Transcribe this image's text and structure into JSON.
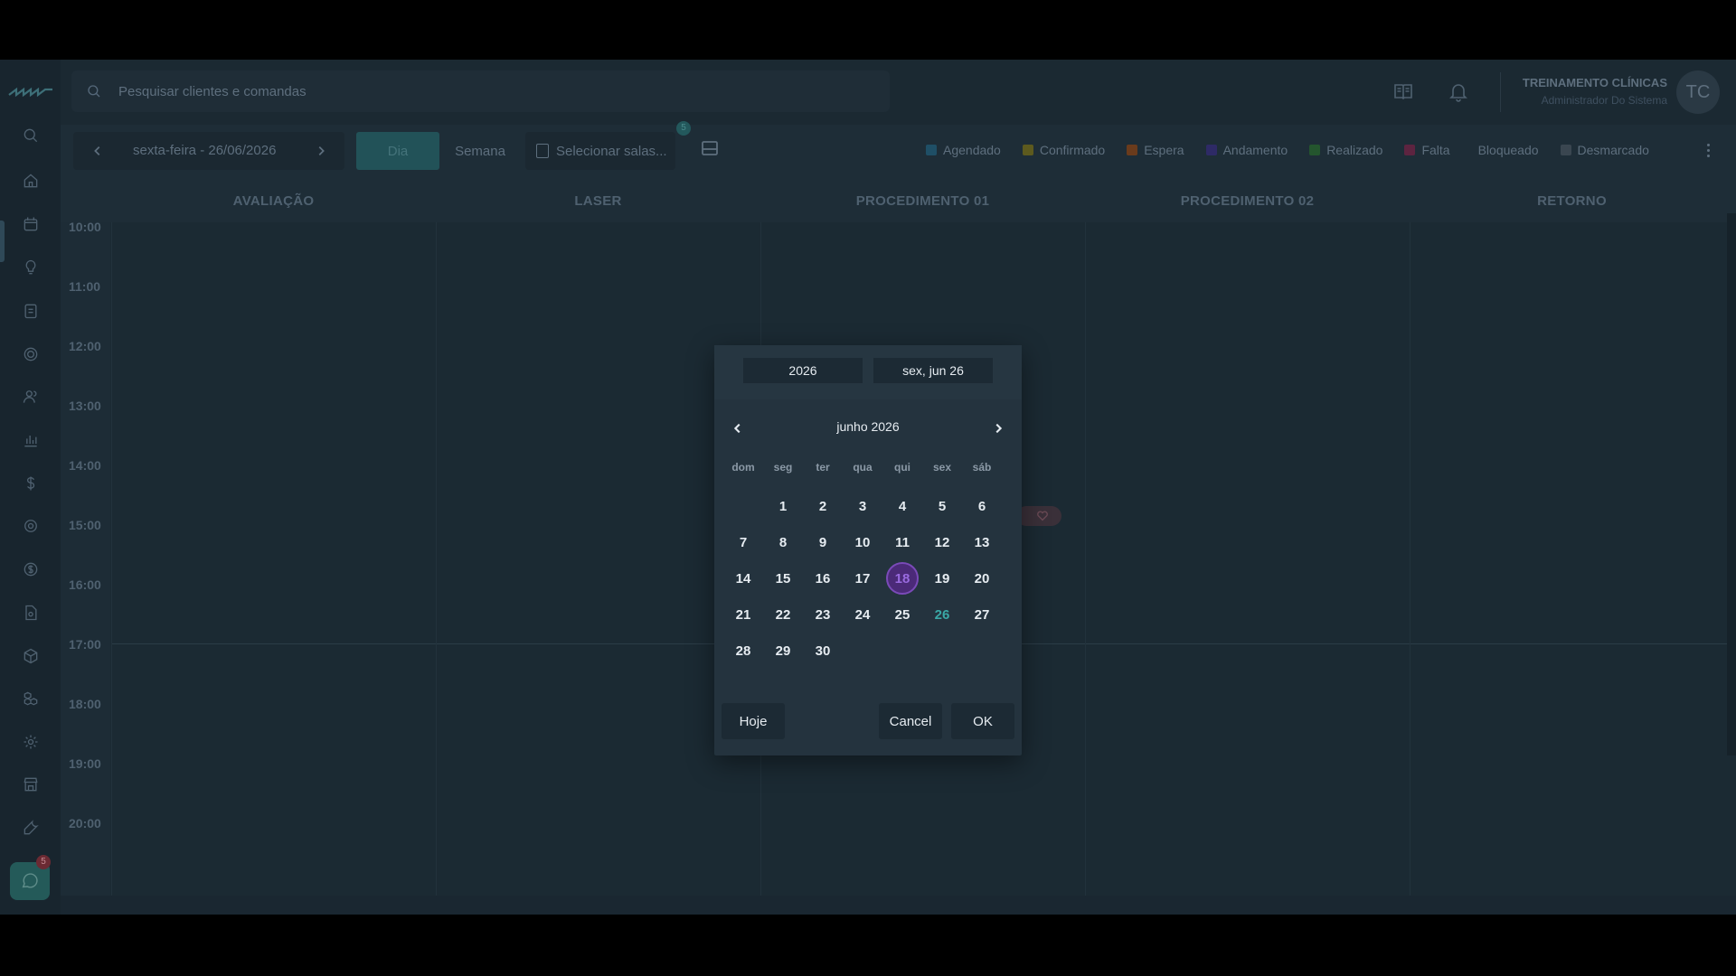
{
  "topbar": {
    "search_placeholder": "Pesquisar clientes e comandas",
    "user_name": "TREINAMENTO CLÍNICAS",
    "user_role": "Administrador Do Sistema",
    "avatar_initials": "TC"
  },
  "sidebar": {
    "icons": [
      "search-icon",
      "home-icon",
      "calendar-icon",
      "lightbulb-icon",
      "clipboard-icon",
      "target-icon",
      "users-icon",
      "chart-icon",
      "dollar-icon",
      "gear-alt-icon",
      "coin-icon",
      "document-gear-icon",
      "box-icon",
      "cubes-icon",
      "settings-icon",
      "store-icon",
      "wrench-icon"
    ],
    "chat_badge": "5"
  },
  "toolbar": {
    "date_label": "sexta-feira - 26/06/2026",
    "day_label": "Dia",
    "week_label": "Semana",
    "rooms_label": "Selecionar salas...",
    "rooms_badge": "5",
    "legend": [
      {
        "label": "Agendado",
        "color": "#1f4f66"
      },
      {
        "label": "Confirmado",
        "color": "#5d5a1e"
      },
      {
        "label": "Espera",
        "color": "#6a3b1c"
      },
      {
        "label": "Andamento",
        "color": "#2e2a66"
      },
      {
        "label": "Realizado",
        "color": "#24552e"
      },
      {
        "label": "Falta",
        "color": "#5d2440"
      },
      {
        "label": "Bloqueado",
        "color": ""
      },
      {
        "label": "Desmarcado",
        "color": "#3a4650"
      }
    ]
  },
  "columns": [
    "AVALIAÇÃO",
    "LASER",
    "PROCEDIMENTO 01",
    "PROCEDIMENTO 02",
    "RETORNO"
  ],
  "times": [
    "10:00",
    "11:00",
    "12:00",
    "13:00",
    "14:00",
    "15:00",
    "16:00",
    "17:00",
    "18:00",
    "19:00",
    "20:00"
  ],
  "picker": {
    "year": "2026",
    "short_date": "sex, jun 26",
    "month_title": "junho 2026",
    "weekdays": [
      "dom",
      "seg",
      "ter",
      "qua",
      "qui",
      "sex",
      "sáb"
    ],
    "first_weekday_index": 1,
    "days_in_month": 30,
    "today": 26,
    "selected": 18,
    "today_button": "Hoje",
    "cancel_button": "Cancel",
    "ok_button": "OK"
  }
}
